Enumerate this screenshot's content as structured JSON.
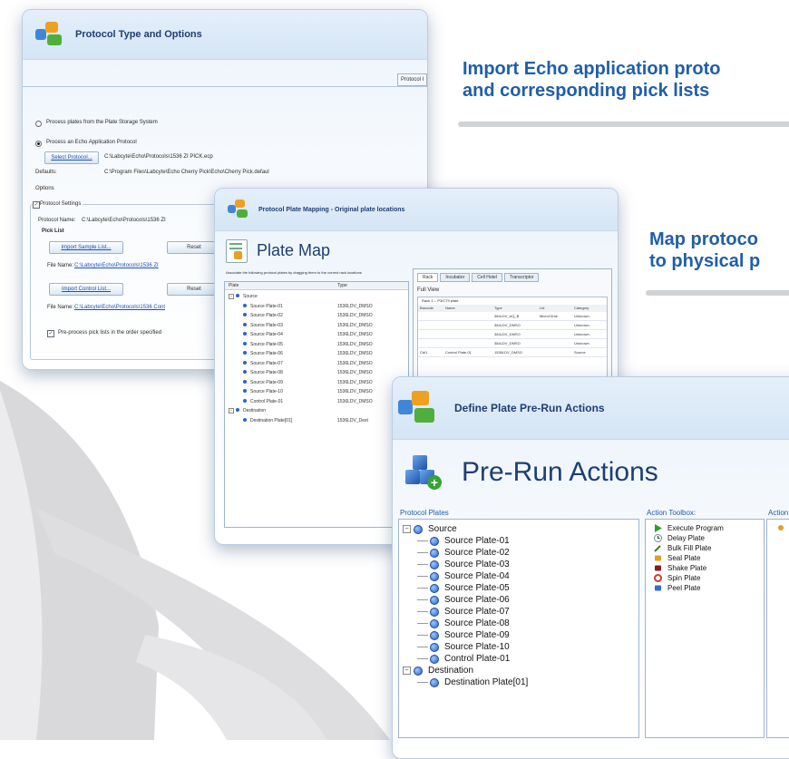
{
  "captions": {
    "import": [
      "Import Echo application proto",
      "and corresponding pick lists"
    ],
    "map": [
      "Map protoco",
      "to physical p"
    ]
  },
  "win1": {
    "title": "Protocol Type and Options",
    "tab_label": "Protocol I",
    "radio_storage": "Process plates from the Plate Storage System",
    "radio_echo": "Process an Echo Application Protocol",
    "select_protocol_btn": "Select Protocol...",
    "protocol_path": "C:\\Labcyte\\Echo\\Protocols\\1536 ZI PICK.ecp",
    "defaults_label": "Defaults:",
    "defaults_path": "C:\\Program Files\\Labcyte\\Echo Cherry Pick\\Echo\\Cherry Pick.defaul",
    "options_label": "Options",
    "group_label": "Protocol Settings",
    "protocol_name_label": "Protocol Name:",
    "protocol_name_value": "C:\\Labcyte\\Echo\\Protocols\\1536 ZI",
    "pick_list_label": "Pick List",
    "import_sample_btn": "Import Sample List...",
    "reset_btn1": "Reset",
    "file_name_label1": "File Name:",
    "file_name_value1": "C:\\Labcyte\\Echo\\Protocols\\1536 ZI",
    "import_control_btn": "Import Control List...",
    "reset_btn2": "Reset",
    "file_name_label2": "File Name:",
    "file_name_value2": "C:\\Labcyte\\Echo\\Protocols\\1536 Cont",
    "preprocess_label": "Pre-process pick lists in the order specified"
  },
  "win2": {
    "title": "Protocol Plate Mapping - Original plate locations",
    "heading": "Plate Map",
    "instructions": "Associate the following protocol plates by dragging them to the correct rack locations",
    "col_plate": "Plate",
    "col_type": "Type",
    "source_label": "Source",
    "source_plates": [
      "Source Plate-01",
      "Source Plate-02",
      "Source Plate-03",
      "Source Plate-04",
      "Source Plate-05",
      "Source Plate-06",
      "Source Plate-07",
      "Source Plate-08",
      "Source Plate-09",
      "Source Plate-10",
      "Control Plate-01"
    ],
    "plate_types": [
      "1536LDV_DMSO",
      "1536LDV_DMSO",
      "1536LDV_DMSO",
      "1536LDV_DMSO",
      "1536LDV_DMSO",
      "1536LDV_DMSO",
      "1536LDV_DMSO",
      "1536LDV_DMSO",
      "1536LDV_DMSO",
      "1536LDV_DMSO",
      "1536LDV_DMSO"
    ],
    "destination_label": "Destination",
    "destination_plate": "Destination Plate[01]",
    "destination_type": "1536LDV_Dest",
    "tabs": [
      "Rack",
      "Incubator",
      "Cell Hotel",
      "Transcriptor"
    ],
    "view_label": "Full View",
    "rack_label": "Rack 1 -- P3/C79 plate",
    "grid_headers": [
      "Barcode",
      "Name",
      "Type",
      "Lid",
      "Category"
    ],
    "grid_rows": [
      [
        "",
        "",
        "384LDV_AQ_B",
        "MicroClime",
        "Unknown"
      ],
      [
        "",
        "",
        "384LDV_DMSO",
        "",
        "Unknown"
      ],
      [
        "",
        "",
        "384LDV_DMSO",
        "",
        "Unknown"
      ],
      [
        "",
        "",
        "384LDV_DMSO",
        "",
        "Unknown"
      ],
      [
        "Ctrl1",
        "Control Plate-01",
        "1536LDV_DMSO",
        "",
        "Source"
      ]
    ]
  },
  "win3": {
    "title": "Define Plate Pre-Run Actions",
    "heading": "Pre-Run Actions",
    "plates_label": "Protocol Plates",
    "toolbox_label": "Action Toolbox:",
    "actions_label": "Action",
    "source_label": "Source",
    "source_plates": [
      "Source Plate-01",
      "Source Plate-02",
      "Source Plate-03",
      "Source Plate-04",
      "Source Plate-05",
      "Source Plate-06",
      "Source Plate-07",
      "Source Plate-08",
      "Source Plate-09",
      "Source Plate-10",
      "Control Plate-01"
    ],
    "destination_label": "Destination",
    "destination_plate": "Destination Plate[01]",
    "toolbox_items": [
      {
        "label": "Execute Program",
        "icon": "play-icon",
        "color": "#2e9e2e"
      },
      {
        "label": "Delay Plate",
        "icon": "clock-icon",
        "color": "#7a8aa0"
      },
      {
        "label": "Bulk Fill Plate",
        "icon": "pipette-icon",
        "color": "#3a7d2a"
      },
      {
        "label": "Seal Plate",
        "icon": "seal-icon",
        "color": "#e0a020"
      },
      {
        "label": "Shake Plate",
        "icon": "shake-icon",
        "color": "#8b1a1a"
      },
      {
        "label": "Spin Plate",
        "icon": "spin-icon",
        "color": "#d33b2c"
      },
      {
        "label": "Peel Plate",
        "icon": "peel-icon",
        "color": "#2f6fd0"
      }
    ]
  }
}
